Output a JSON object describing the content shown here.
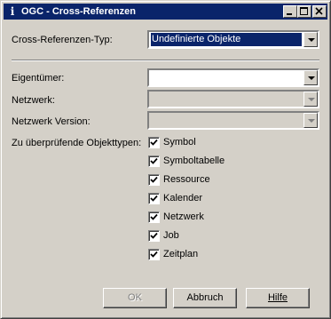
{
  "window": {
    "title": "OGC - Cross-Referenzen",
    "icon": "info-icon",
    "controls": {
      "minimize": "_",
      "maximize": "□",
      "close": "×"
    }
  },
  "type": {
    "label": "Cross-Referenzen-Typ:",
    "value": "Undefinierte Objekte"
  },
  "owner": {
    "label": "Eigentümer:",
    "value": ""
  },
  "network": {
    "label": "Netzwerk:",
    "value": ""
  },
  "network_version": {
    "label": "Netzwerk Version:",
    "value": ""
  },
  "object_types": {
    "label": "Zu überprüfende Objekttypen:",
    "items": [
      {
        "label": "Symbol",
        "checked": true
      },
      {
        "label": "Symboltabelle",
        "checked": true
      },
      {
        "label": "Ressource",
        "checked": true
      },
      {
        "label": "Kalender",
        "checked": true
      },
      {
        "label": "Netzwerk",
        "checked": true
      },
      {
        "label": "Job",
        "checked": true
      },
      {
        "label": "Zeitplan",
        "checked": true
      }
    ]
  },
  "buttons": {
    "ok": "OK",
    "cancel": "Abbruch",
    "help": "Hilfe"
  },
  "colors": {
    "titlebar": "#0a246a",
    "face": "#d4d0c8",
    "selection": "#0a246a"
  }
}
